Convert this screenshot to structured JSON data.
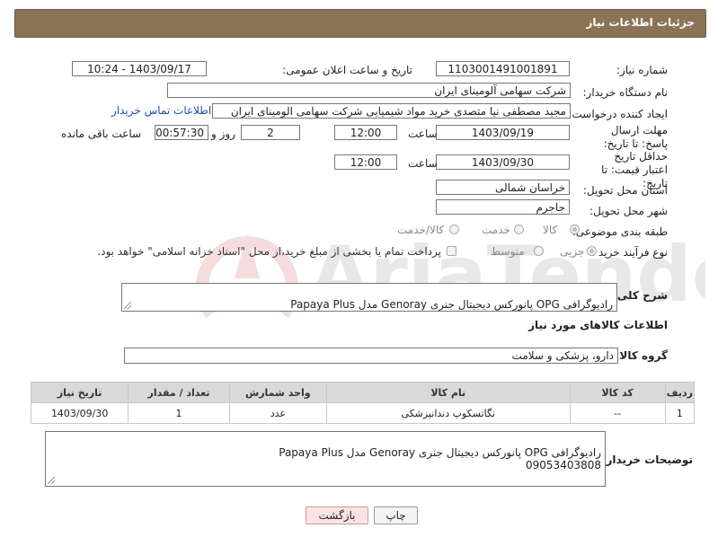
{
  "header": {
    "title": "جزئیات اطلاعات نیاز"
  },
  "fields": {
    "need_number_label": "شماره نیاز:",
    "need_number": "1103001491001891",
    "announce_label": "تاریخ و ساعت اعلان عمومی:",
    "announce_value": "1403/09/17 - 10:24",
    "buyer_org_label": "نام دستگاه خریدار:",
    "buyer_org": "شرکت سهامی آلومینای ایران",
    "creator_label": "ایجاد کننده درخواست:",
    "creator": "مجید مصطفی نیا متصدی خرید مواد شیمیایی شرکت سهامی الومینای ایران",
    "contact_link": "اطلاعات تماس خریدار",
    "deadline_label": "مهلت ارسال پاسخ: تا تاریخ:",
    "deadline_date": "1403/09/19",
    "time_label": "ساعت",
    "deadline_time": "12:00",
    "days": "2",
    "days_label": "روز و",
    "remaining": "00:57:30",
    "remaining_label": "ساعت باقی مانده",
    "validity_label": "حداقل تاریخ اعتبار قیمت: تا تاریخ:",
    "validity_date": "1403/09/30",
    "validity_time": "12:00",
    "province_label": "استان محل تحویل:",
    "province": "خراسان شمالی",
    "city_label": "شهر محل تحویل:",
    "city": "جاجرم",
    "category_label": "طبقه بندی موضوعی:",
    "category_options": [
      "کالا",
      "خدمت",
      "کالا/خدمت"
    ],
    "process_label": "نوع فرآیند خرید :",
    "process_options": [
      "جزیی",
      "متوسط"
    ],
    "payment_note": "پرداخت تمام یا بخشی از مبلغ خرید،از محل \"اسناد خزانه اسلامی\" خواهد بود.",
    "summary_label": "شرح کلی نیاز:",
    "summary": "رادیوگرافی OPG پانورکس دیجیتال جنری Genoray مدل Papaya Plus",
    "goods_info_title": "اطلاعات کالاهای مورد نیاز",
    "goods_group_label": "گروه کالا:",
    "goods_group": "دارو، پزشکی و سلامت"
  },
  "table": {
    "headers": [
      "ردیف",
      "کد کالا",
      "نام کالا",
      "واحد شمارش",
      "تعداد / مقدار",
      "تاریخ نیاز"
    ],
    "rows": [
      [
        "1",
        "--",
        "نگاتسکوپ دندانپزشکی",
        "عدد",
        "1",
        "1403/09/30"
      ]
    ]
  },
  "buyer_notes_label": "توضیحات خریدار:",
  "buyer_notes": "رادیوگرافی OPG پانورکس دیجیتال جنری Genoray مدل Papaya Plus\n09053403808",
  "buttons": {
    "print": "چاپ",
    "back": "بازگشت"
  },
  "watermark": "AriaTender.neT",
  "colors": {
    "header_bg": "#8b7355",
    "table_header_bg": "#d9d9d9",
    "link": "#1a4fb3",
    "back_button_bg": "#fde4e4"
  }
}
